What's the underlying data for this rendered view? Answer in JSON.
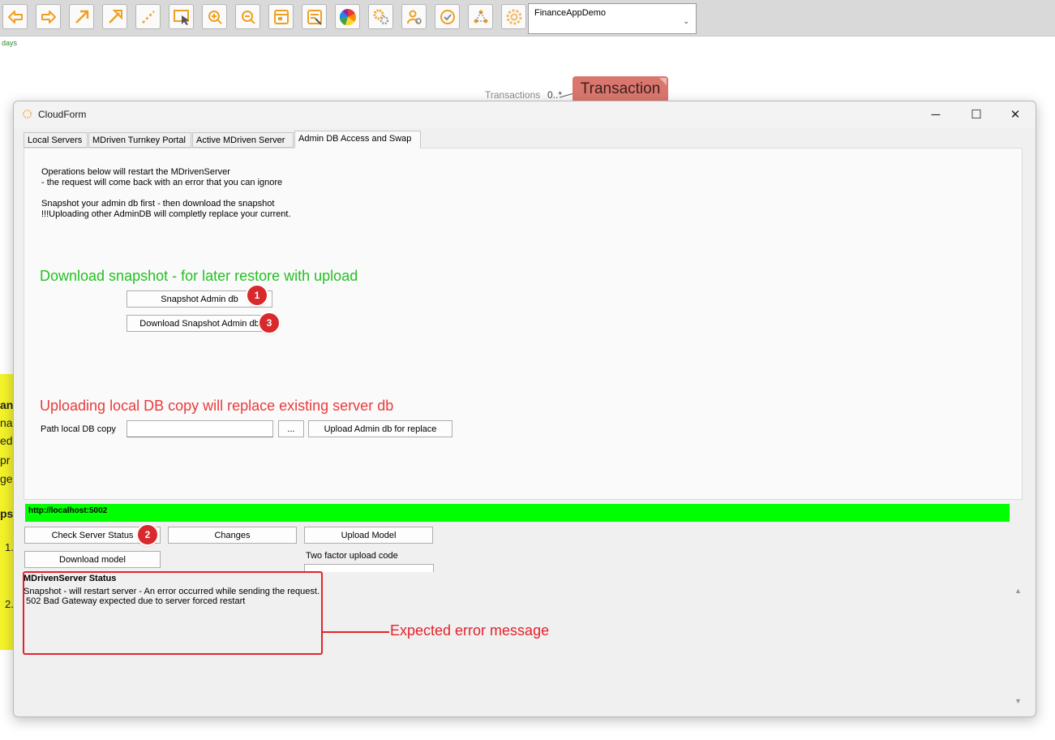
{
  "toolbar": {
    "buttons": [
      {
        "icon": "back-arrow-icon"
      },
      {
        "icon": "forward-arrow-icon"
      },
      {
        "icon": "association-arrow-icon"
      },
      {
        "icon": "inheritance-arrow-icon"
      },
      {
        "icon": "dashed-line-icon"
      },
      {
        "icon": "select-pointer-icon"
      },
      {
        "icon": "zoom-in-icon"
      },
      {
        "icon": "zoom-out-icon"
      },
      {
        "icon": "window-icon"
      },
      {
        "icon": "form-icon"
      },
      {
        "icon": "color-wheel-icon"
      },
      {
        "icon": "gears-icon"
      },
      {
        "icon": "users-icon"
      },
      {
        "icon": "check-icon"
      },
      {
        "icon": "nodes-icon"
      },
      {
        "icon": "cloud-gear-icon"
      }
    ],
    "model_select_value": "FinanceAppDemo",
    "days_label": "days",
    "colors": {
      "accent": "#f5a623",
      "background": "#d9d9d9"
    }
  },
  "diagram": {
    "transactions_label": "Transactions",
    "multiplicity": "0..*",
    "transaction_class": "Transaction"
  },
  "window": {
    "title": "CloudForm",
    "controls": {
      "minimize": "─",
      "maximize": "☐",
      "close": "✕"
    }
  },
  "tabs": [
    {
      "label": "Local Servers",
      "active": false
    },
    {
      "label": "MDriven Turnkey Portal",
      "active": false
    },
    {
      "label": "Active MDriven Server",
      "active": false
    },
    {
      "label": "Admin DB Access and Swap",
      "active": true
    }
  ],
  "panel": {
    "info_lines": [
      "Operations below will restart the MDrivenServer",
      "- the request will come back with an error that you can ignore",
      "Snapshot your admin db first - then download the snapshot",
      "!!!Uploading other AdminDB will completly replace your current."
    ],
    "download_heading": "Download snapshot - for later restore with upload",
    "snapshot_button": "Snapshot Admin db",
    "download_snapshot_button": "Download Snapshot Admin db",
    "upload_heading": "Uploading local DB copy will replace existing server db",
    "path_label": "Path local DB copy",
    "path_value": "",
    "browse_button": "...",
    "upload_admin_button": "Upload Admin db for replace"
  },
  "server": {
    "url": "http://localhost:5002",
    "url_bar_color": "#00ff00",
    "check_status_button": "Check Server Status",
    "changes_button": "Changes",
    "upload_model_button": "Upload Model",
    "download_model_button": "Download model",
    "two_factor_label": "Two factor upload code",
    "two_factor_value": ""
  },
  "status": {
    "title": "MDrivenServer Status",
    "lines": [
      "Snapshot - will restart server - An error occurred while sending the request.",
      " 502 Bad Gateway expected due to server forced restart"
    ]
  },
  "annotations": {
    "badge_snapshot": "1",
    "badge_check_status": "2",
    "badge_download": "3",
    "expected_error": "Expected error message",
    "badge_color": "#d8292c"
  },
  "background_note_fragments": [
    "an",
    "nag",
    "ed",
    "pr",
    "ge",
    "ps",
    "1.",
    "2."
  ]
}
